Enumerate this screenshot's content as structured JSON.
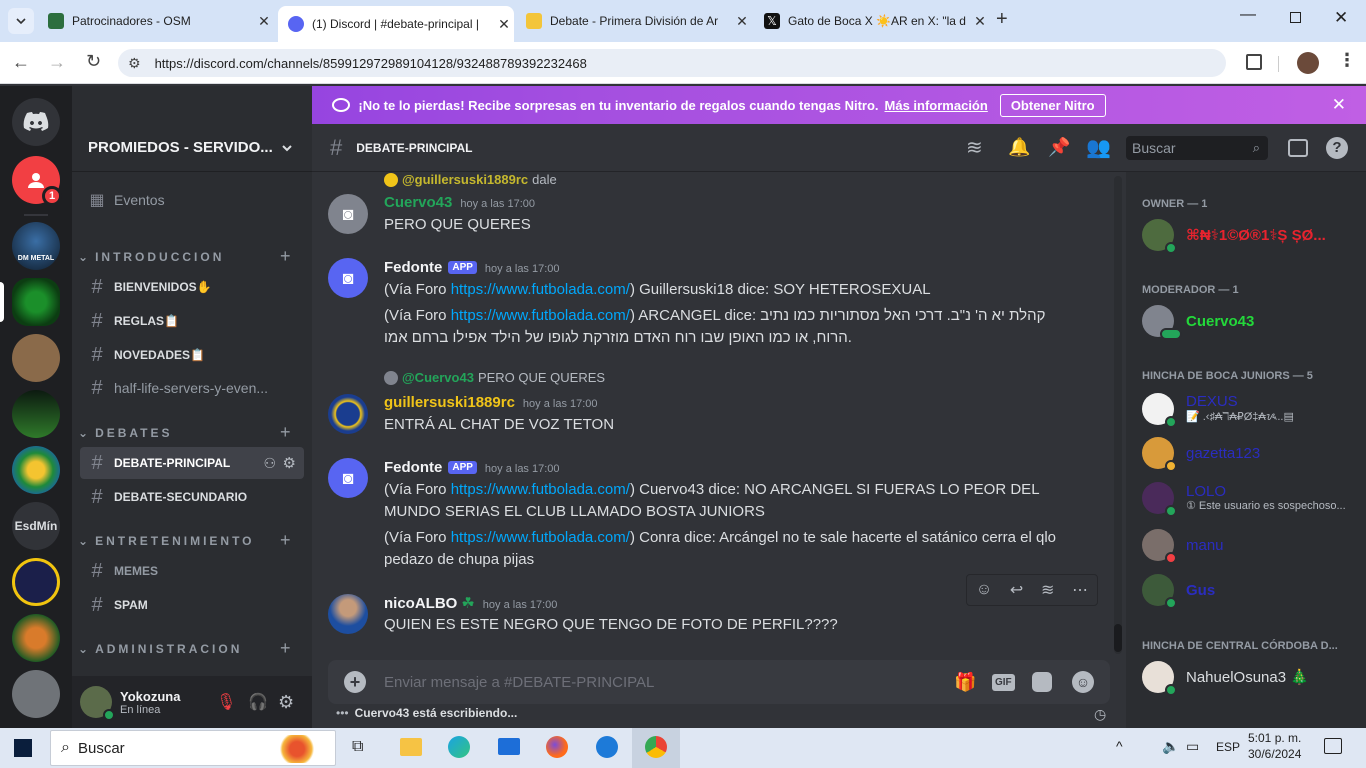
{
  "browser": {
    "tabs": [
      {
        "title": "Patrocinadores - OSM"
      },
      {
        "title": "(1) Discord | #debate-principal |"
      },
      {
        "title": "Debate - Primera División de Ar"
      },
      {
        "title": "Gato de Boca X ☀️AR en X: \"la d"
      }
    ],
    "url": "https://discord.com/channels/859912972989104128/932488789392232468"
  },
  "nitro_banner": {
    "text": "¡No te lo pierdas! Recibe sorpresas en tu inventario de regalos cuando tengas Nitro.",
    "link": "Más información",
    "button": "Obtener Nitro"
  },
  "guilds": {
    "badge": "1",
    "text_server": "EsdMín"
  },
  "server": {
    "name": "PROMIEDOS - SERVIDO...",
    "events": "Eventos",
    "categories": [
      {
        "name": "INTRODUCCION",
        "channels": [
          "BIENVENIDOS✋",
          "REGLAS📋",
          "NOVEDADES📋",
          "half-life-servers-y-even..."
        ]
      },
      {
        "name": "DEBATES",
        "channels": [
          "DEBATE-PRINCIPAL",
          "DEBATE-SECUNDARIO"
        ]
      },
      {
        "name": "ENTRETENIMIENTO",
        "channels": [
          "MEMES",
          "SPAM"
        ]
      },
      {
        "name": "ADMINISTRACION",
        "channels": []
      }
    ]
  },
  "user": {
    "name": "Yokozuna",
    "status": "En línea"
  },
  "channel": {
    "name": "DEBATE-PRINCIPAL",
    "search_placeholder": "Buscar"
  },
  "messages": [
    {
      "reply_to": "@guillersuski1889rc",
      "reply_text": "dale",
      "author": "Cuervo43",
      "time": "hoy a las 17:00",
      "lines": [
        "PERO QUE QUERES"
      ]
    },
    {
      "author": "Fedonte",
      "tag": "APP",
      "time": "hoy a las 17:00",
      "l1_prefix": "(Vía Foro ",
      "l1_link": "https://www.futbolada.com/",
      "l1_rest": ") Guillersuski18 dice: SOY HETEROSEXUAL",
      "l2_prefix": "(Vía Foro ",
      "l2_link": "https://www.futbolada.com/",
      "l2_rest": ") ARCANGEL dice:  קהלת יא ה' נ\"ב. דרכי האל מסתוריות כמו נתיב",
      "l2_cont": "הרוח, או כמו האופן שבו רוח האדם מוזרקת לגופו של הילד אפילו ברחם אמו."
    },
    {
      "reply_to": "@Cuervo43",
      "reply_text": "PERO QUE QUERES",
      "author": "guillersuski1889rc",
      "time": "hoy a las 17:00",
      "lines": [
        "ENTRÁ AL CHAT DE VOZ TETON"
      ]
    },
    {
      "author": "Fedonte",
      "tag": "APP",
      "time": "hoy a las 17:00",
      "l1_prefix": "(Vía Foro ",
      "l1_link": "https://www.futbolada.com/",
      "l1_rest": ") Cuervo43 dice: NO ARCANGEL SI FUERAS LO PEOR DEL MUNDO SERIAS EL CLUB LLAMADO BOSTA JUNIORS",
      "l2_prefix": "(Vía Foro ",
      "l2_link": "https://www.futbolada.com/",
      "l2_rest": ") Conra dice: Arcángel no te sale hacerte el satánico cerra el qlo pedazo de chupa pijas"
    },
    {
      "author": "nicoALBO",
      "time": "hoy a las 17:00",
      "lines": [
        "QUIEN ES ESTE NEGRO QUE TENGO DE FOTO DE PERFIL????"
      ]
    }
  ],
  "composer": {
    "placeholder": "Enviar mensaje a #DEBATE-PRINCIPAL",
    "typing": "Cuervo43 está escribiendo...",
    "gif_label": "GIF"
  },
  "members": {
    "groups": [
      {
        "title": "OWNER — 1",
        "members": [
          {
            "name": "⌘₦⚕1©Ø®1⚕Ș ȘØ..."
          }
        ]
      },
      {
        "title": "MODERADOR — 1",
        "members": [
          {
            "name": "Cuervo43"
          }
        ]
      },
      {
        "title": "HINCHA DE BOCA JUNIORS — 5",
        "members": [
          {
            "name": "DEXUS",
            "sub": "📝 .‹♯₳ℸ₳₽Ø‡₳ᝰ..▤"
          },
          {
            "name": "gazetta123"
          },
          {
            "name": "LOLO",
            "sub": "① Este usuario es sospechoso..."
          },
          {
            "name": "manu"
          },
          {
            "name": "Gus"
          }
        ]
      },
      {
        "title": "HINCHA DE CENTRAL CÓRDOBA D...",
        "members": [
          {
            "name": "NahuelOsuna3 🎄"
          }
        ]
      }
    ]
  },
  "taskbar": {
    "search": "Buscar",
    "time": "5:01 p. m.",
    "date": "30/6/2024",
    "lang": "ESP"
  },
  "colors": {
    "blurple": "#5865f2",
    "green": "#23a55a",
    "link": "#00a8fc",
    "gold": "#f0c419",
    "navy_member": "#2a2dbf"
  }
}
